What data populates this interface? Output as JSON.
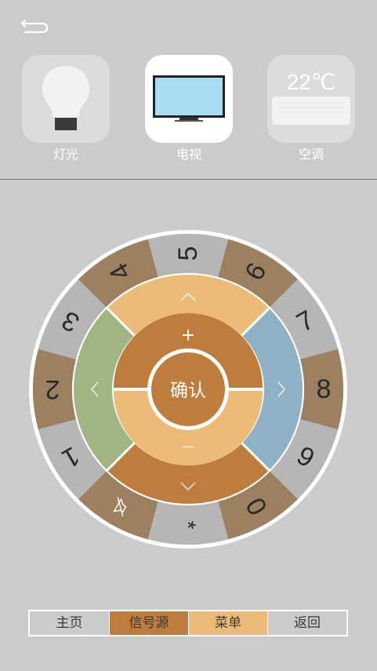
{
  "devices": {
    "light_label": "灯光",
    "tv_label": "电视",
    "ac_label": "空调",
    "ac_temp": "22℃"
  },
  "remote": {
    "digits": [
      "5",
      "6",
      "7",
      "8",
      "9",
      "0",
      "*",
      "1",
      "2",
      "3",
      "4"
    ],
    "vol_up": "+",
    "vol_down": "—",
    "ok_label": "确认",
    "mute_icon": "mute-icon"
  },
  "tabs": {
    "home": "主页",
    "source": "信号源",
    "menu": "菜单",
    "back": "返回"
  },
  "colors": {
    "background": "#cbcbcb",
    "brown_dark": "#bf7d3d",
    "orange_light": "#ecbb78",
    "green": "#a0b582",
    "blue": "#8fb1c6",
    "ring_brown": "#9c8060",
    "ring_gray": "#b6b6b6"
  }
}
